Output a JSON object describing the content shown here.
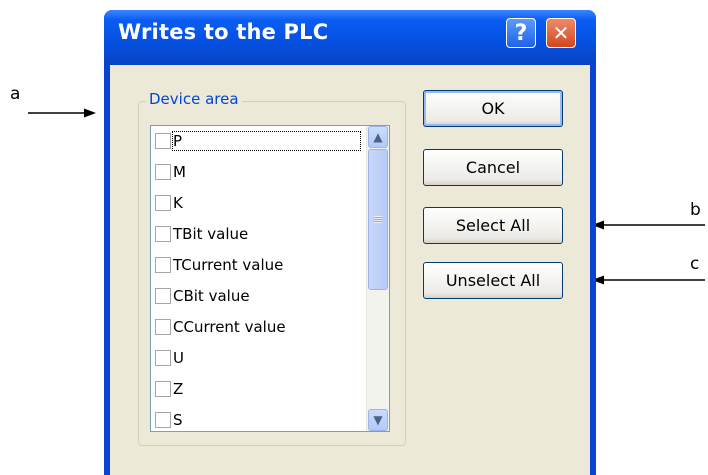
{
  "dialog": {
    "title": "Writes to the PLC",
    "help_glyph": "?",
    "close_glyph": "✕"
  },
  "groupbox": {
    "label": "Device area",
    "items": [
      {
        "label": "P",
        "checked": false
      },
      {
        "label": "M",
        "checked": false
      },
      {
        "label": "K",
        "checked": false
      },
      {
        "label": "TBit value",
        "checked": false
      },
      {
        "label": "TCurrent value",
        "checked": false
      },
      {
        "label": "CBit value",
        "checked": false
      },
      {
        "label": "CCurrent value",
        "checked": false
      },
      {
        "label": "U",
        "checked": false
      },
      {
        "label": "Z",
        "checked": false
      },
      {
        "label": "S",
        "checked": false
      }
    ],
    "scroll_up_glyph": "▲",
    "scroll_down_glyph": "▼"
  },
  "buttons": {
    "ok": "OK",
    "cancel": "Cancel",
    "select_all": "Select All",
    "unselect_all": "Unselect All"
  },
  "annotations": {
    "a": "a",
    "b": "b",
    "c": "c"
  },
  "colors": {
    "titlebar": "#0550e0",
    "client_bg": "#ece9d8",
    "group_label": "#0046d5",
    "button_border": "#003c74"
  }
}
